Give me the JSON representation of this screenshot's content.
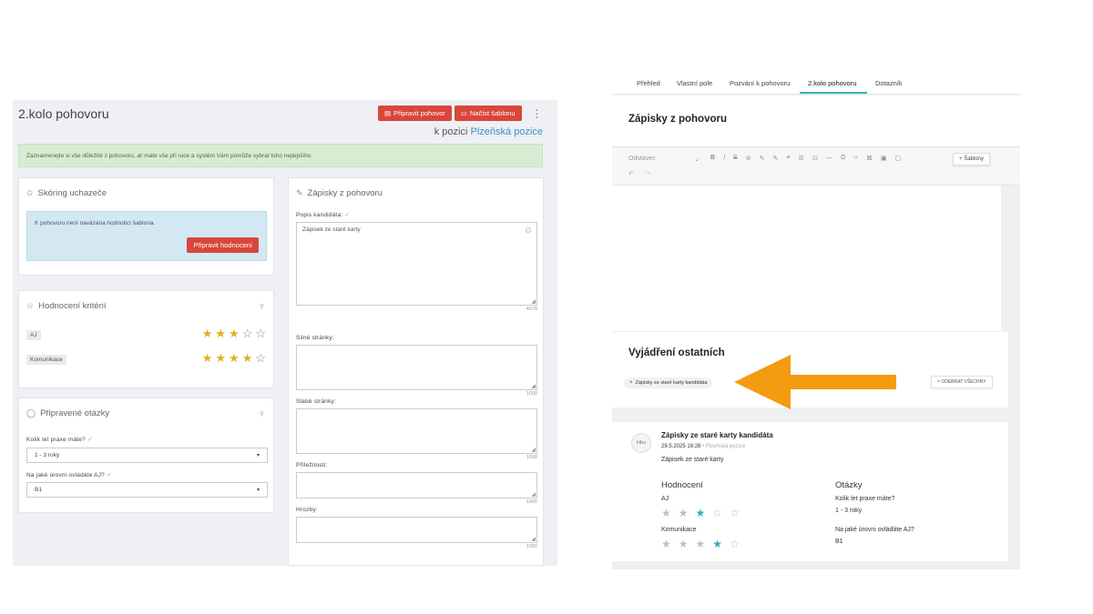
{
  "left": {
    "title": "2.kolo pohovoru",
    "buttons": {
      "prepare": "Připravit pohovor",
      "load": "Načíst šablonu"
    },
    "position_prefix": "k pozici",
    "position_link": "Plzeňská pozice",
    "info": "Zaznamenejte si vše důležité z pohovoru, ať máte vše při ruce a systém Vám pomůže vybrat toho nejlepšího.",
    "scoring": {
      "title": "Skóring uchazeče",
      "message": "K pohovoru není navázána hodnoticí šablona.",
      "button": "Připravit hodnocení"
    },
    "criteria": {
      "title": "Hodnocení kritérií",
      "items": [
        {
          "label": "AJ",
          "rating": 3
        },
        {
          "label": "Komunikace",
          "rating": 4
        }
      ]
    },
    "questions": {
      "title": "Připravené otázky",
      "items": [
        {
          "label": "Kolik let praxe máte?",
          "value": "1 - 3 roky"
        },
        {
          "label": "Na jaké úrovni ovládáte AJ?",
          "value": "B1"
        }
      ]
    },
    "notes": {
      "title": "Zápisky z pohovoru",
      "fields": [
        {
          "label": "Popis kandidáta:",
          "value": "Zápisek ze staré karty",
          "counter": "4978"
        },
        {
          "label": "Silné stránky:",
          "value": "",
          "counter": "1000"
        },
        {
          "label": "Slabé stránky:",
          "value": "",
          "counter": "1000"
        },
        {
          "label": "Příležitosti:",
          "value": "",
          "counter": "1000"
        },
        {
          "label": "Hrozby:",
          "value": "",
          "counter": "1000"
        }
      ]
    }
  },
  "right": {
    "tabs": [
      "Přehled",
      "Vlastní pole",
      "Pozvání k pohovoru",
      "2.kolo pohovoru",
      "Dotazník"
    ],
    "active_tab": "2.kolo pohovoru",
    "notes_title": "Zápisky z pohovoru",
    "editor": {
      "paragraph": "Odstavec",
      "templates_button": "Šablony"
    },
    "others_title": "Vyjádření ostatních",
    "chip": "Zápisky ze staré karty kandidáta",
    "remove_all": "ODEBRAT VŠECHNY",
    "entry": {
      "avatar": "Hbu",
      "title": "Zápisky ze staré karty kandidáta",
      "date": "29.5.2025 16:28",
      "position": "Plzeňská pozice",
      "text": "Zápisek ze staré karty",
      "ratings_title": "Hodnocení",
      "ratings": [
        {
          "label": "AJ",
          "rating": 3
        },
        {
          "label": "Komunikace",
          "rating": 4
        }
      ],
      "questions_title": "Otázky",
      "questions": [
        {
          "q": "Kolik let praxe máte?",
          "a": "1 - 3 roky"
        },
        {
          "q": "Na jaké úrovni ovládáte AJ?",
          "a": "B1"
        }
      ]
    }
  },
  "colors": {
    "accent_red": "#d9463b",
    "teal": "#2ab3b8",
    "arrow": "#f39c12",
    "star_gold": "#e0b31e"
  }
}
